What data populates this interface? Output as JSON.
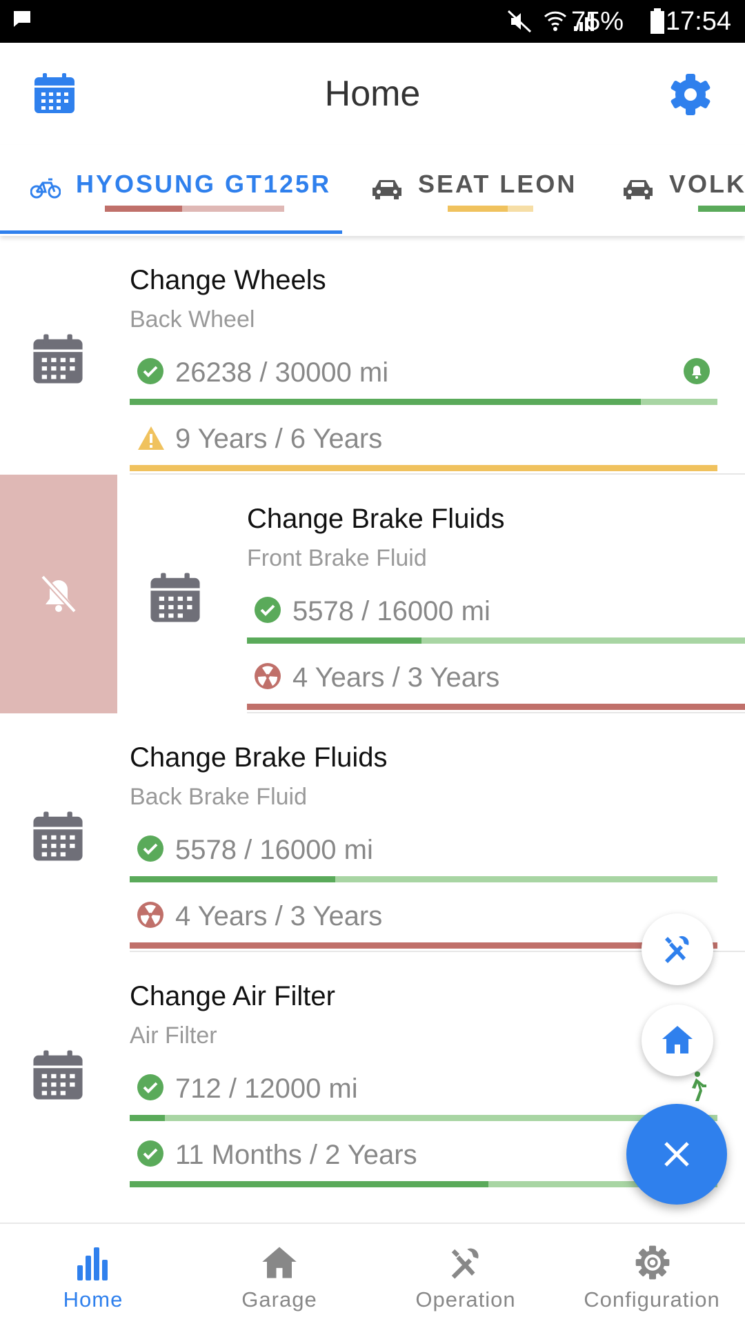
{
  "status_bar": {
    "battery": "75%",
    "time": "17:54"
  },
  "header": {
    "title": "Home"
  },
  "tabs": [
    {
      "label": "HYOSUNG GT125R",
      "icon": "bicycle-icon",
      "active": true
    },
    {
      "label": "SEAT LEON",
      "icon": "car-icon",
      "active": false
    },
    {
      "label": "VOLKS",
      "icon": "car-icon",
      "active": false
    }
  ],
  "swipe_action": {
    "icon": "bell-off-icon"
  },
  "items": [
    {
      "title": "Change Wheels",
      "subtitle": "Back Wheel",
      "distance": "26238 / 30000 mi",
      "distance_status": "ok",
      "distance_progress": 0.87,
      "time": "9 Years / 6 Years",
      "time_status": "warning",
      "time_progress": 1.0,
      "trailing_icon": "bell-icon"
    },
    {
      "title": "Change Brake Fluids",
      "subtitle": "Front Brake Fluid",
      "distance": "5578 / 16000 mi",
      "distance_status": "ok",
      "distance_progress": 0.35,
      "time": "4 Years / 3 Years",
      "time_status": "danger",
      "time_progress": 1.0
    },
    {
      "title": "Change Brake Fluids",
      "subtitle": "Back Brake Fluid",
      "distance": "5578 / 16000 mi",
      "distance_status": "ok",
      "distance_progress": 0.35,
      "time": "4 Years / 3 Years",
      "time_status": "danger",
      "time_progress": 1.0
    },
    {
      "title": "Change Air Filter",
      "subtitle": "Air Filter",
      "distance": "712 / 12000 mi",
      "distance_status": "ok",
      "distance_progress": 0.06,
      "time": "11 Months / 2 Years",
      "time_status": "ok",
      "time_progress": 0.61,
      "trailing_icon": "walking-icon"
    }
  ],
  "bottom_nav": [
    {
      "label": "Home",
      "icon": "bar-chart-icon",
      "active": true
    },
    {
      "label": "Garage",
      "icon": "house-icon",
      "active": false
    },
    {
      "label": "Operation",
      "icon": "tools-icon",
      "active": false
    },
    {
      "label": "Configuration",
      "icon": "gear-icon",
      "active": false
    }
  ],
  "fab": {
    "mini1_icon": "tools-icon",
    "mini2_icon": "house-icon",
    "main_icon": "close-icon"
  },
  "colors": {
    "accent": "#2f80ed",
    "ok": "#5aaa5a",
    "ok_light": "#a8d5a3",
    "warning": "#f0c25e",
    "danger": "#c0706a",
    "danger_light": "#dfb8b5",
    "icon_gray": "#6f6f78"
  }
}
